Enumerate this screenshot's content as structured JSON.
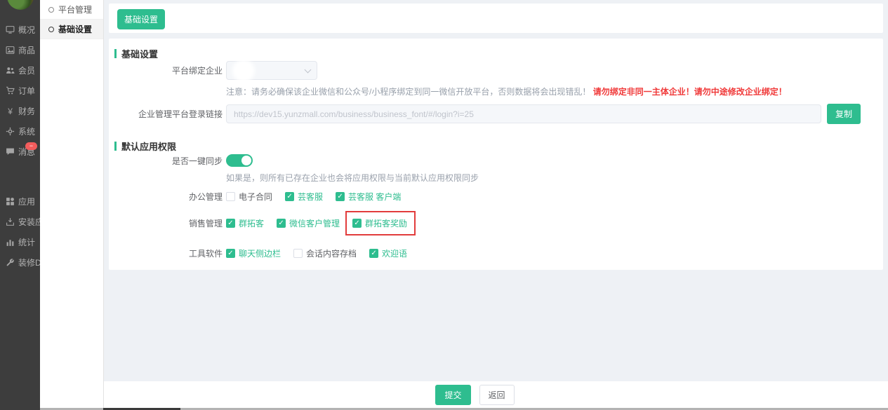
{
  "app": {
    "accent_color": "#2ebd8f",
    "warning_color": "#f03a3a",
    "highlight_border_color": "#e23c3c",
    "badge_color": "#f25c5c"
  },
  "sidebar": {
    "items": [
      {
        "label": "概况",
        "icon": "overview-icon"
      },
      {
        "label": "商品",
        "icon": "goods-icon"
      },
      {
        "label": "会员",
        "icon": "members-icon"
      },
      {
        "label": "订单",
        "icon": "orders-icon"
      },
      {
        "label": "财务",
        "icon": "finance-icon"
      },
      {
        "label": "系统",
        "icon": "system-icon"
      },
      {
        "label": "消息",
        "icon": "message-icon",
        "badge": "−",
        "gap_after": true
      },
      {
        "label": "应用",
        "icon": "apps-icon"
      },
      {
        "label": "安装应用",
        "icon": "install-app-icon"
      },
      {
        "label": "统计",
        "icon": "stats-icon"
      },
      {
        "label": "装修DIY",
        "icon": "diy-icon"
      }
    ]
  },
  "submenu": {
    "items": [
      {
        "label": "平台管理",
        "active": false
      },
      {
        "label": "基础设置",
        "active": true
      }
    ]
  },
  "toolbar": {
    "tab_label": "基础设置"
  },
  "form": {
    "section_basic_title": "基础设置",
    "bind_enterprise_label": "平台绑定企业",
    "note_text": "注意：请务必确保该企业微信和公众号/小程序绑定到同一微信开放平台，否则数据将会出现错乱！",
    "note_warning": "请勿绑定非同一主体企业！请勿中途修改企业绑定！",
    "login_link_label": "企业管理平台登录链接",
    "login_link_value": "https://dev15.yunzmall.com/business/business_font/#/login?i=25",
    "copy_button_label": "复制",
    "section_permission_title": "默认应用权限",
    "sync_label": "是否一键同步",
    "sync_enabled": true,
    "sync_help": "如果是，则所有已存在企业也会将应用权限与当前默认应用权限同步",
    "permission_groups": [
      {
        "label": "办公管理",
        "options": [
          {
            "label": "电子合同",
            "checked": false
          },
          {
            "label": "芸客服",
            "checked": true
          },
          {
            "label": "芸客服 客户端",
            "checked": true
          }
        ]
      },
      {
        "label": "销售管理",
        "options": [
          {
            "label": "群拓客",
            "checked": true
          },
          {
            "label": "微信客户管理",
            "checked": true
          },
          {
            "label": "群拓客奖励",
            "checked": true,
            "highlighted": true
          }
        ]
      },
      {
        "label": "工具软件",
        "options": [
          {
            "label": "聊天侧边栏",
            "checked": true
          },
          {
            "label": "会话内容存档",
            "checked": false
          },
          {
            "label": "欢迎语",
            "checked": true
          }
        ]
      }
    ]
  },
  "footer": {
    "submit_label": "提交",
    "back_label": "返回"
  }
}
